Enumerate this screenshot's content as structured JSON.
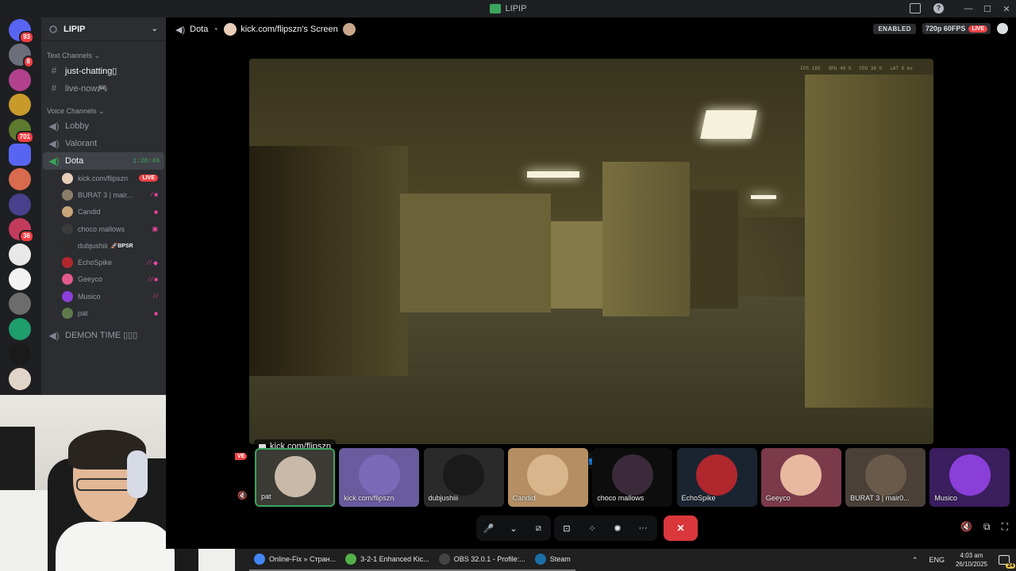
{
  "window": {
    "title": "LIPIP",
    "controls": [
      "—",
      "☐",
      "✕"
    ]
  },
  "guilds": [
    {
      "color": "#5865f2",
      "badge": "93"
    },
    {
      "color": "#6b6f7a",
      "badge": "8"
    },
    {
      "color": "#b2418c",
      "badge": ""
    },
    {
      "color": "#c79a2b",
      "badge": ""
    },
    {
      "color": "#5d7a2f",
      "badge": "701"
    },
    {
      "color": "#5865f2",
      "badge": ""
    },
    {
      "color": "#d86a4d",
      "badge": ""
    },
    {
      "color": "#4a3f8c",
      "badge": ""
    },
    {
      "color": "#c23b5b",
      "badge": "36"
    },
    {
      "color": "#e8e8e8",
      "badge": ""
    },
    {
      "color": "#f2f2f2",
      "badge": ""
    },
    {
      "color": "#6c6c6c",
      "badge": ""
    },
    {
      "color": "#1f9d6b",
      "badge": ""
    },
    {
      "color": "#1a1a1a",
      "badge": ""
    },
    {
      "color": "#e1d5c9",
      "badge": ""
    }
  ],
  "server": {
    "name": "LIPIP"
  },
  "text_channels": {
    "category": "Text Channels ⌄",
    "items": [
      {
        "icon": "#",
        "label": "just-chatting▯"
      },
      {
        "icon": "#",
        "label": "live-now🎮"
      }
    ]
  },
  "voice_channels": {
    "category": "Voice Channels ⌄",
    "items": [
      {
        "label": "Lobby"
      },
      {
        "label": "Valorant"
      },
      {
        "label": "Dota",
        "time": "1:20:49"
      }
    ],
    "users": [
      {
        "name": "kick.com/flipszn",
        "live": "LIVE",
        "color": "#e8cdb8",
        "icons": ""
      },
      {
        "name": "BURAT 3 | mair...",
        "color": "#8a7d6a",
        "icons": "⁄ ■"
      },
      {
        "name": "Candid",
        "color": "#c9a47a",
        "icons": "■"
      },
      {
        "name": "choco mallows",
        "color": "#3a3a3a",
        "icons": "▣"
      },
      {
        "name": "dubjushiii",
        "tag": "🚀BPSR",
        "color": "#2c2c2c",
        "icons": ""
      },
      {
        "name": "EchoSpike",
        "color": "#b0272e",
        "icons": "⁄ ⁄ ◆"
      },
      {
        "name": "Geeyco",
        "color": "#e05b8a",
        "icons": "⁄ ⁄ ■"
      },
      {
        "name": "Musico",
        "color": "#8b3fd9",
        "icons": "⁄ ⁄"
      },
      {
        "name": "pat",
        "color": "#5d7a4a",
        "icons": "■"
      }
    ],
    "extra": {
      "label": "DEMON TIME ▯▯▯"
    }
  },
  "stage": {
    "channel": "Dota",
    "stream_title": "kick.com/flipszn's Screen",
    "enabled_label": "ENABLED",
    "quality": "720p 60FPS",
    "live": "LIVE",
    "video_label": "kick.com/flipszn",
    "hud": {
      "fps": "FPS 165",
      "gpu": "GPU 48 %",
      "cpu": "CPU 36 %",
      "lat": "LAT 0 ms"
    }
  },
  "strip": {
    "live_tag": "VE",
    "tiles": [
      {
        "name": "pat",
        "color": "#3b3a34",
        "avatar": "#c8b9a8"
      },
      {
        "name": "kick.com/flipszn",
        "color": "#6a5b9e",
        "avatar": "#7a6ab8"
      },
      {
        "name": "dubjushiii",
        "color": "#2a2a2a",
        "avatar": "#1a1a1a"
      },
      {
        "name": "Candid",
        "color": "#b58f63",
        "avatar": "#d8b58a"
      },
      {
        "name": "choco mallows",
        "color": "#0d0d0d",
        "avatar": "#3a2a3a"
      },
      {
        "name": "EchoSpike",
        "color": "#1a2430",
        "avatar": "#b0272e"
      },
      {
        "name": "Geeyco",
        "color": "#7a3a4a",
        "avatar": "#e8b8a0"
      },
      {
        "name": "BURAT 3 | mair0...",
        "color": "#4a4038",
        "avatar": "#6a5a4a"
      },
      {
        "name": "Musico",
        "color": "#3a1e5e",
        "avatar": "#8b3fd9"
      }
    ]
  },
  "controls": {
    "mic": "🎤",
    "camera": "⧄",
    "stream": "⊡",
    "activities": "⁘",
    "soundboard": "✺",
    "more": "···",
    "leave": "✕",
    "right": [
      "🔇",
      "⧉",
      "⛶"
    ]
  },
  "taskbar": {
    "items": [
      {
        "label": "Online-Fix » Стран...",
        "color": "#4285f4"
      },
      {
        "label": "3-2-1 Enhanced Kic...",
        "color": "#53b04a"
      },
      {
        "label": "OBS 32.0.1 - Profile:...",
        "color": "#444"
      },
      {
        "label": "Steam",
        "color": "#1b6fa8"
      }
    ],
    "lang": "ENG",
    "time": "4:03 am",
    "date": "26/10/2025",
    "notif": "24"
  }
}
